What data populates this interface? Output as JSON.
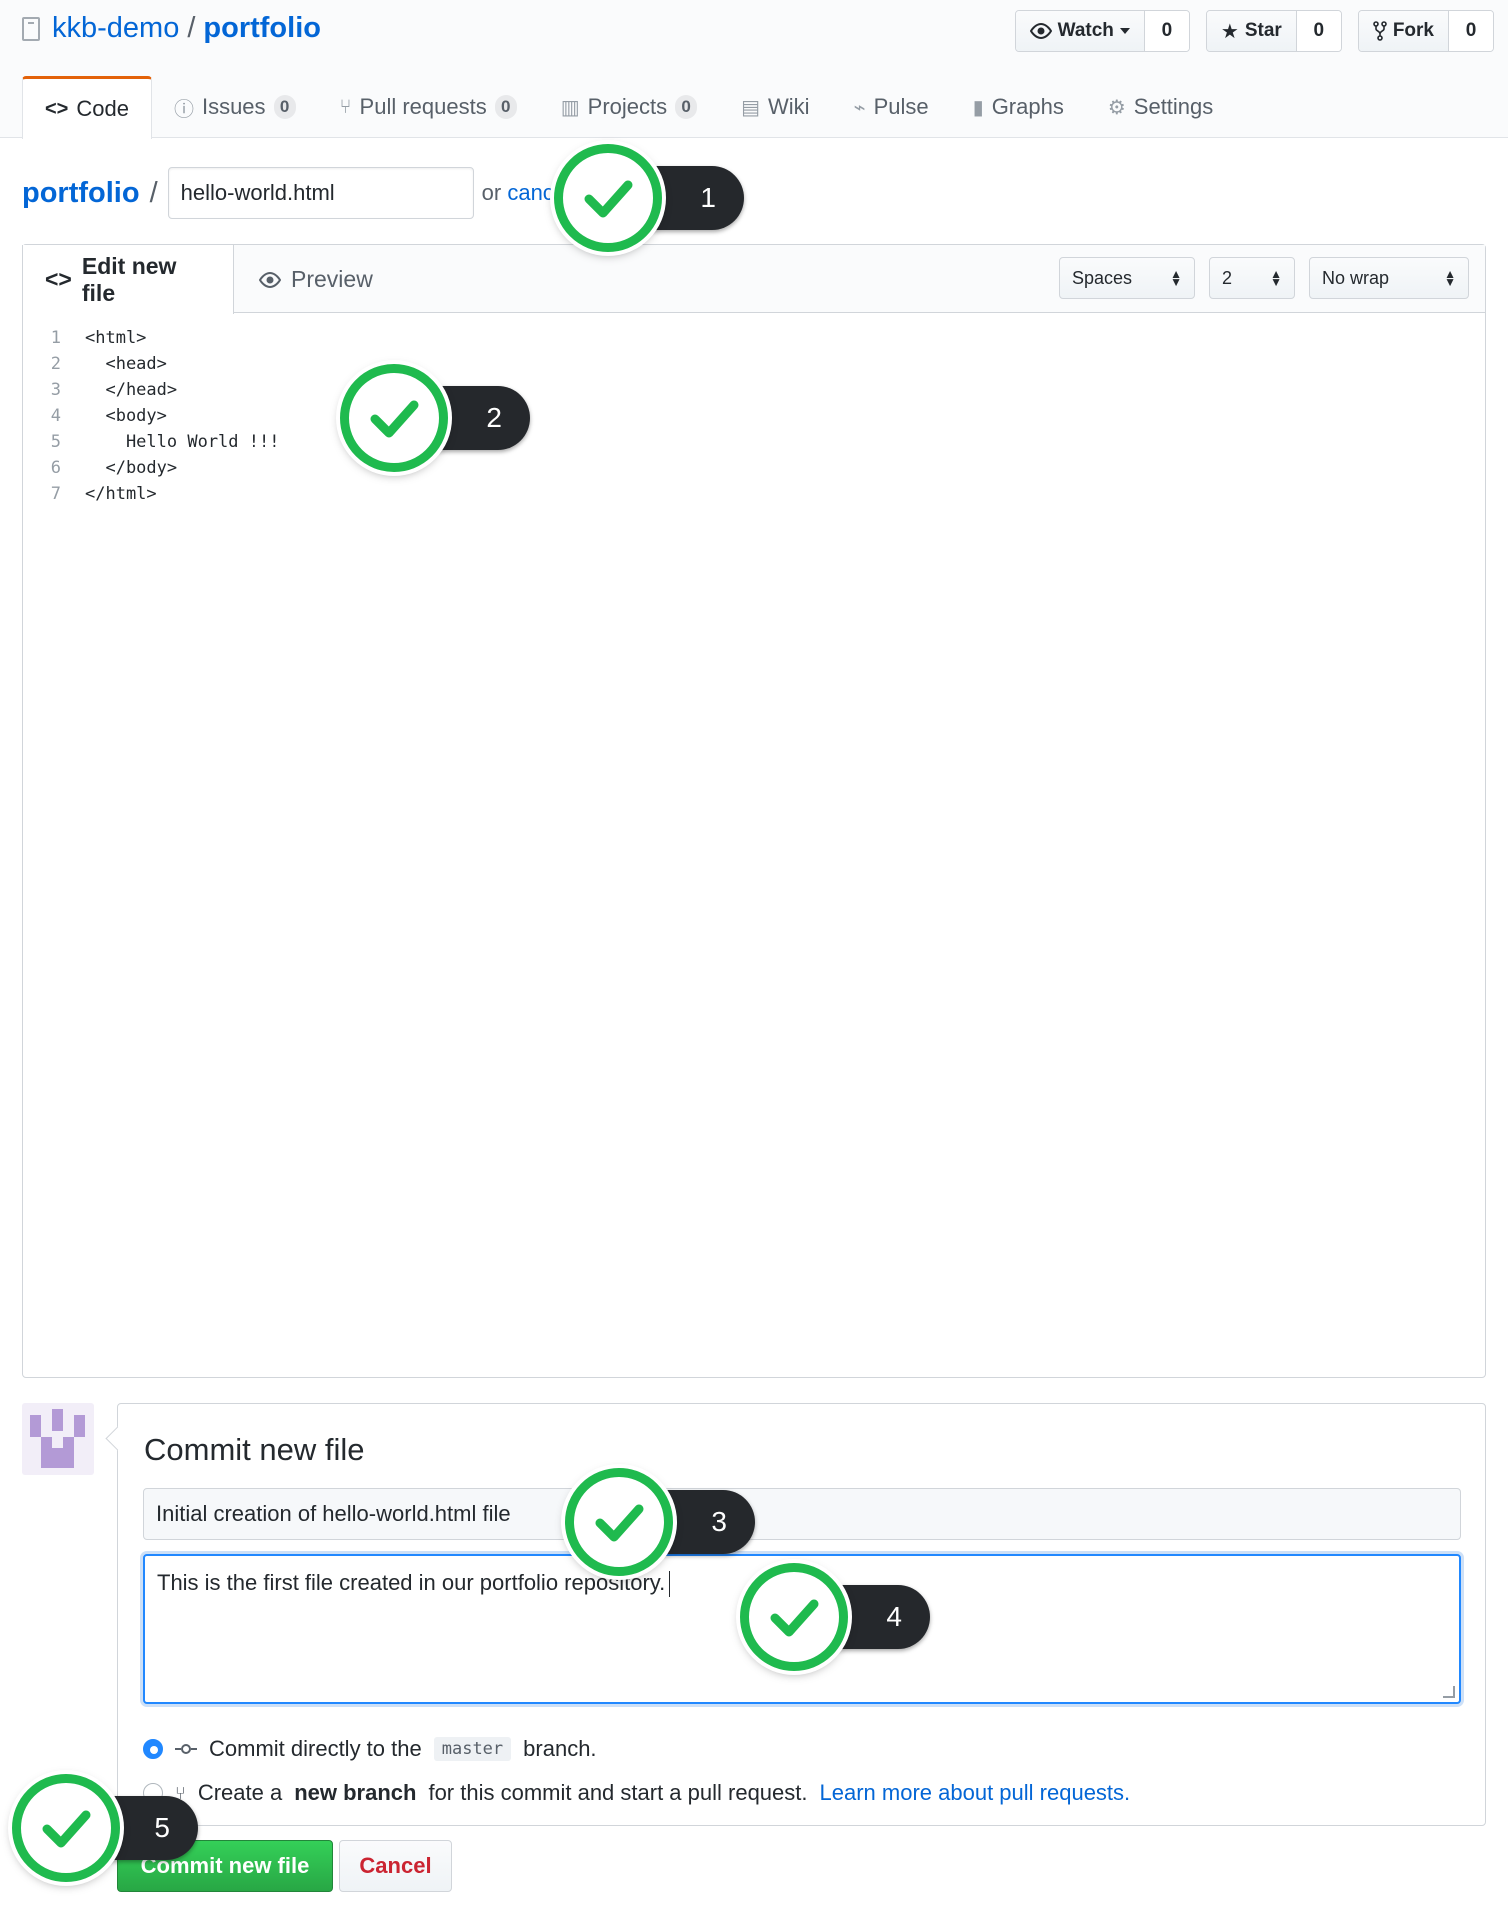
{
  "repo": {
    "owner": "kkb-demo",
    "separator": "/",
    "name": "portfolio"
  },
  "actions": {
    "watch": {
      "label": "Watch",
      "count": "0",
      "icon": "eye-icon"
    },
    "star": {
      "label": "Star",
      "count": "0",
      "icon": "star-icon"
    },
    "fork": {
      "label": "Fork",
      "count": "0",
      "icon": "fork-icon"
    }
  },
  "tabs": [
    {
      "label": "Code",
      "icon": "code-icon",
      "selected": true
    },
    {
      "label": "Issues",
      "count": "0",
      "icon": "issue-icon"
    },
    {
      "label": "Pull requests",
      "count": "0",
      "icon": "pull-request-icon"
    },
    {
      "label": "Projects",
      "count": "0",
      "icon": "project-icon"
    },
    {
      "label": "Wiki",
      "icon": "book-icon"
    },
    {
      "label": "Pulse",
      "icon": "pulse-icon"
    },
    {
      "label": "Graphs",
      "icon": "graph-icon"
    },
    {
      "label": "Settings",
      "icon": "gear-icon"
    }
  ],
  "breadcrumb": {
    "root": "portfolio",
    "slash": "/",
    "filename": "hello-world.html",
    "or": "or",
    "cancel": "canc"
  },
  "editor": {
    "edit_tab": "Edit new file",
    "preview_tab": "Preview",
    "indent_mode": "Spaces",
    "indent_size": "2",
    "wrap_mode": "No wrap",
    "lines": [
      {
        "n": "1",
        "text": "<html>"
      },
      {
        "n": "2",
        "text": "  <head>"
      },
      {
        "n": "3",
        "text": "  </head>"
      },
      {
        "n": "4",
        "text": "  <body>"
      },
      {
        "n": "5",
        "text": "    Hello World !!!"
      },
      {
        "n": "6",
        "text": "  </body>"
      },
      {
        "n": "7",
        "text": "</html>"
      }
    ]
  },
  "commit": {
    "title": "Commit new file",
    "summary": "Initial creation of hello-world.html file",
    "description": "This is the first file created in our portfolio repository.",
    "option_direct_prefix": "Commit directly to the",
    "branch": "master",
    "option_direct_suffix": "branch.",
    "option_new_prefix": "Create a",
    "option_new_bold": "new branch",
    "option_new_suffix": "for this commit and start a pull request.",
    "learn_more": "Learn more about pull requests.",
    "commit_button": "Commit new file",
    "cancel_button": "Cancel"
  },
  "markers": [
    "1",
    "2",
    "3",
    "4",
    "5"
  ],
  "colors": {
    "link": "#0366d6",
    "commit_green": "#28a745",
    "marker_green": "#1fba4e",
    "cancel_red": "#cb2431",
    "tab_accent": "#e36209"
  }
}
